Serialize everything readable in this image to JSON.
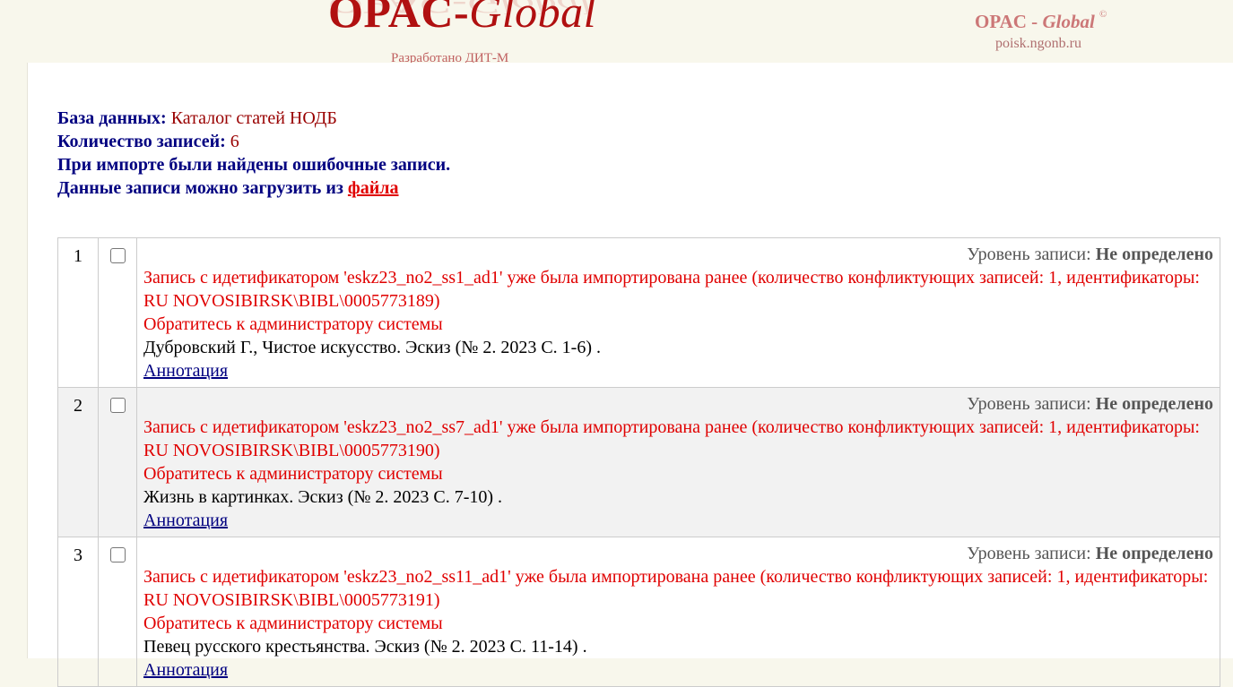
{
  "header": {
    "logo_opac": "OPAC",
    "logo_dash": "-",
    "logo_global": "Global",
    "developed_by": "Разработано ДИТ-М",
    "brand_opac": "OPAC - ",
    "brand_global": "Global",
    "brand_copyright": "©",
    "site": "poisk.ngonb.ru"
  },
  "info": {
    "db_label": "База данных:",
    "db_value": "Каталог статей НОДБ",
    "count_label": "Количество записей:",
    "count_value": "6",
    "error_line": "При импорте были найдены ошибочные записи.",
    "download_text": "Данные записи можно загрузить из",
    "download_link": "файла"
  },
  "level_label": "Уровень записи:",
  "records": [
    {
      "num": "1",
      "level": "Не определено",
      "error": "Запись с идетификатором 'eskz23_no2_ss1_ad1' уже была импортирована ранее (количество конфликтующих записей: 1, идентификаторы: RU NOVOSIBIRSK\\BIBL\\0005773189)",
      "contact": "Обратитесь к администратору системы",
      "description": "Дубровский Г., Чистое искусство. Эскиз (№ 2. 2023 С. 1-6) .",
      "annotation": "Аннотация"
    },
    {
      "num": "2",
      "level": "Не определено",
      "error": "Запись с идетификатором 'eskz23_no2_ss7_ad1' уже была импортирована ранее (количество конфликтующих записей: 1, идентификаторы: RU NOVOSIBIRSK\\BIBL\\0005773190)",
      "contact": "Обратитесь к администратору системы",
      "description": "Жизнь в картинках. Эскиз (№ 2. 2023 С. 7-10) .",
      "annotation": "Аннотация"
    },
    {
      "num": "3",
      "level": "Не определено",
      "error": "Запись с идетификатором 'eskz23_no2_ss11_ad1' уже была импортирована ранее (количество конфликтующих записей: 1, идентификаторы: RU NOVOSIBIRSK\\BIBL\\0005773191)",
      "contact": "Обратитесь к администратору системы",
      "description": "Певец русского крестьянства. Эскиз (№ 2. 2023 С. 11-14) .",
      "annotation": "Аннотация"
    }
  ]
}
